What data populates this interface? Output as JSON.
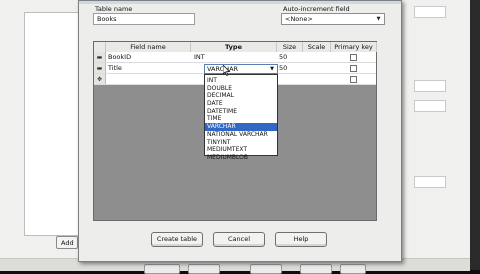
{
  "background": {
    "add_label": "Add"
  },
  "dialog": {
    "table_name_label": "Table name",
    "table_name_value": "Books",
    "auto_increment_label": "Auto-increment field",
    "auto_increment_value": "<None>",
    "columns": {
      "field_name": "Field name",
      "type": "Type",
      "size": "Size",
      "scale": "Scale",
      "primary_key": "Primary key"
    },
    "rows": [
      {
        "field": "BookID",
        "type": "INT",
        "size": "50",
        "row_icon": "drag-handle-icon"
      },
      {
        "field": "Title",
        "type": "VARCHAR",
        "size": "50",
        "row_icon": "drag-handle-icon"
      },
      {
        "field": "",
        "type": "",
        "size": "",
        "row_icon": "new-row-icon"
      }
    ],
    "type_options": [
      "INT",
      "DOUBLE",
      "DECIMAL",
      "DATE",
      "DATETIME",
      "TIME",
      "VARCHAR",
      "NATIONAL VARCHAR",
      "TINYINT",
      "MEDIUMTEXT",
      "MEDIUMBLOB"
    ],
    "selected_type": "VARCHAR",
    "buttons": {
      "create": "Create table",
      "cancel": "Cancel",
      "help": "Help"
    }
  },
  "colors": {
    "selection": "#3168c6",
    "grid_empty": "#8e8e8e",
    "dialog_bg": "#ededeb"
  }
}
